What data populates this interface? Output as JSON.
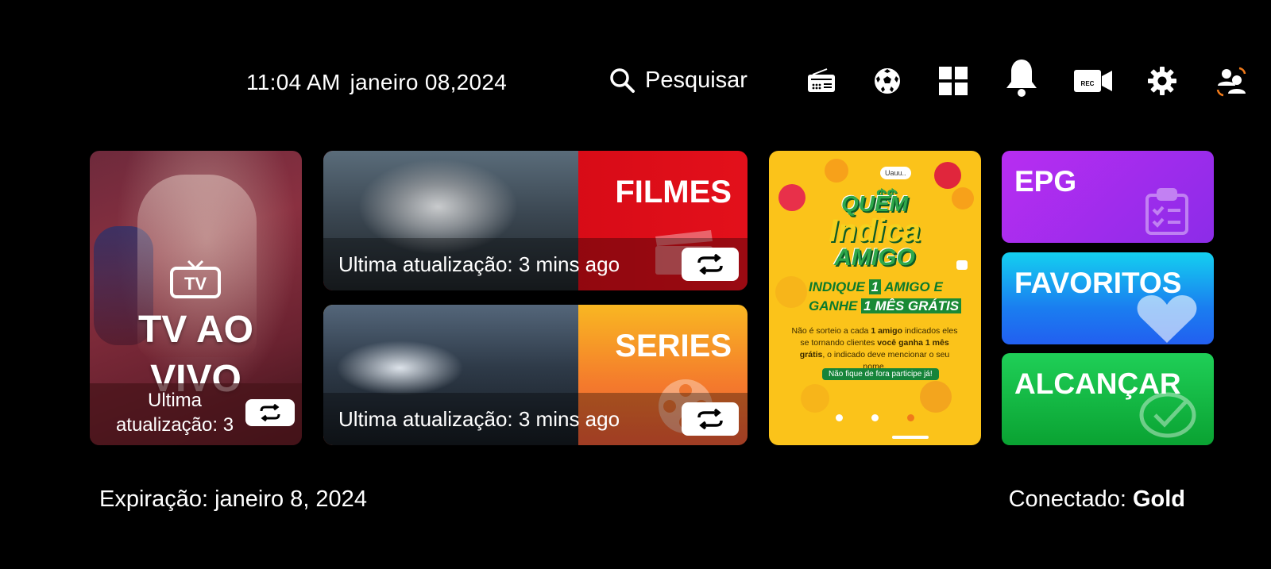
{
  "header": {
    "time": "11:04 AM",
    "date": "janeiro 08,2024",
    "search_label": "Pesquisar",
    "icons": [
      "radio-icon",
      "soccer-ball-icon",
      "grid-icon",
      "bell-icon",
      "rec-camera-icon",
      "gear-icon",
      "switch-user-icon"
    ],
    "rec_badge": "REC"
  },
  "live_tv": {
    "title": "TV AO VIVO",
    "tv_icon_label": "TV",
    "update_text": "Ultima atualização: 3"
  },
  "movies": {
    "title": "FILMES",
    "update_text": "Ultima atualização: 3 mins ago"
  },
  "series": {
    "title": "SERIES",
    "update_text": "Ultima atualização: 3 mins ago"
  },
  "promo": {
    "headline_1": "QUEM",
    "headline_2": "Indica",
    "headline_3": "AMIGO",
    "offer_1": "INDIQUE",
    "offer_num": "1",
    "offer_2": "AMIGO E",
    "offer_3": "GANHE",
    "offer_4": "1 MÊS GRÁTIS",
    "body_a": "Não é sorteio a cada",
    "body_b": "1 amigo",
    "body_c": "indicados eles se tornando clientes",
    "body_d": "você ganha 1 mês grátis",
    "body_e": ", o indicado deve mencionar o seu nome.",
    "cta": "Não fique de fora participe já!",
    "chat_bubble": "Uauu..",
    "dollar": "$$",
    "slides": 3,
    "active_slide": 3
  },
  "tiles": {
    "epg": "EPG",
    "favorites": "FAVORITOS",
    "reach": "ALCANÇAR"
  },
  "footer": {
    "expiration": "Expiração: janeiro 8, 2024",
    "connected_label": "Conectado:",
    "connected_value": "Gold"
  },
  "colors": {
    "background": "#000000",
    "movies": "#e3101b",
    "series": "#f47c2c",
    "promo": "#fbc31a",
    "epg": "#b82df1",
    "favorites": "#1a7ef0",
    "reach": "#0aa232"
  }
}
